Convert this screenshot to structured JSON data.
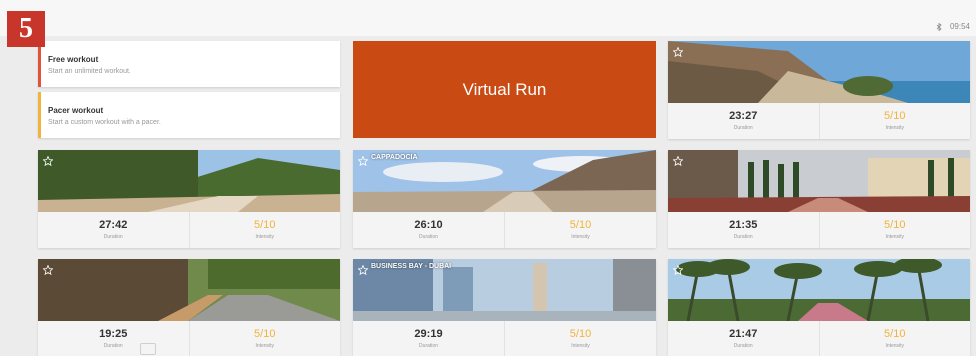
{
  "step_number": "5",
  "status_bar": {
    "time": "09:54",
    "bluetooth_icon": "bluetooth-icon"
  },
  "modes": [
    {
      "title": "Free workout",
      "subtitle": "Start an unlimited workout.",
      "accent": "#e0543a"
    },
    {
      "title": "Pacer workout",
      "subtitle": "Start a custom workout with a pacer.",
      "accent": "#f0b43a"
    }
  ],
  "virtual_run": {
    "label": "Virtual Run",
    "color": "#c94a13"
  },
  "labels": {
    "duration": "Duration",
    "intensity": "Intensity"
  },
  "routes": [
    {
      "title": "",
      "duration": "23:27",
      "intensity": "5/10"
    },
    {
      "title": "",
      "duration": "27:42",
      "intensity": "5/10"
    },
    {
      "title": "CAPPADOCIA",
      "duration": "26:10",
      "intensity": "5/10"
    },
    {
      "title": "",
      "duration": "21:35",
      "intensity": "5/10"
    },
    {
      "title": "",
      "duration": "19:25",
      "intensity": "5/10"
    },
    {
      "title": "BUSINESS BAY - DUBAI",
      "duration": "29:19",
      "intensity": "5/10"
    },
    {
      "title": "",
      "duration": "21:47",
      "intensity": "5/10"
    }
  ],
  "accent_colors": {
    "intensity": "#f0b43a",
    "badge": "#c8352b"
  }
}
